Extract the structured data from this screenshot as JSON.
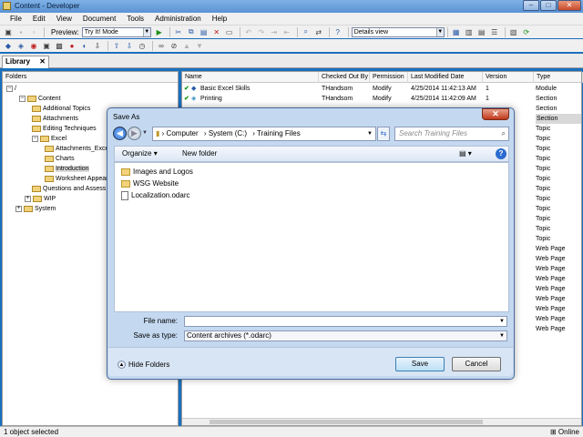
{
  "window": {
    "title": "Content - Developer"
  },
  "menu": [
    "File",
    "Edit",
    "View",
    "Document",
    "Tools",
    "Administration",
    "Help"
  ],
  "toolbar": {
    "preview_label": "Preview:",
    "preview_mode": "Try It! Mode",
    "view_mode": "Details view"
  },
  "tab": {
    "label": "Library",
    "close": "✕"
  },
  "folders": {
    "header": "Folders",
    "nodes": [
      {
        "label": "/"
      },
      {
        "label": "Content"
      },
      {
        "label": "Additional Topics"
      },
      {
        "label": "Attachments"
      },
      {
        "label": "Editing Techniques"
      },
      {
        "label": "Excel"
      },
      {
        "label": "Attachments_Excel"
      },
      {
        "label": "Charts"
      },
      {
        "label": "Introduction"
      },
      {
        "label": "Worksheet Appear"
      },
      {
        "label": "Questions and Assess"
      },
      {
        "label": "WIP"
      },
      {
        "label": "System"
      }
    ]
  },
  "list": {
    "columns": [
      "Name",
      "Checked Out By",
      "Permission",
      "Last Modified Date",
      "Version",
      "Type"
    ],
    "rows": [
      {
        "name": "Basic Excel Skills",
        "checked_out_by": "THandsom",
        "permission": "Modify",
        "modified": "4/25/2014 11:42:13 AM",
        "version": "1",
        "type": "Module"
      },
      {
        "name": "Printing",
        "checked_out_by": "THandsom",
        "permission": "Modify",
        "modified": "4/25/2014 11:42:09 AM",
        "version": "1",
        "type": "Section"
      }
    ],
    "types_below": [
      "Section",
      "Section",
      "Topic",
      "Topic",
      "Topic",
      "Topic",
      "Topic",
      "Topic",
      "Topic",
      "Topic",
      "Topic",
      "Topic",
      "Topic",
      "Topic",
      "Web Page",
      "Web Page",
      "Web Page",
      "Web Page",
      "Web Page",
      "Web Page",
      "Web Page",
      "Web Page",
      "Web Page"
    ]
  },
  "status": {
    "text": "1 object selected",
    "online": "Online"
  },
  "dialog": {
    "title": "Save As",
    "close": "✕",
    "breadcrumb": [
      "Computer",
      "System (C:)",
      "Training Files"
    ],
    "search_placeholder": "Search Training Files",
    "organize": "Organize",
    "new_folder": "New folder",
    "files": [
      {
        "name": "Images and Logos",
        "kind": "folder"
      },
      {
        "name": "WSG Website",
        "kind": "folder"
      },
      {
        "name": "Localization.odarc",
        "kind": "file"
      }
    ],
    "file_name_label": "File name:",
    "file_name_value": "",
    "save_type_label": "Save as type:",
    "save_type_value": "Content archives (*.odarc)",
    "hide_folders": "Hide Folders",
    "save": "Save",
    "cancel": "Cancel"
  }
}
